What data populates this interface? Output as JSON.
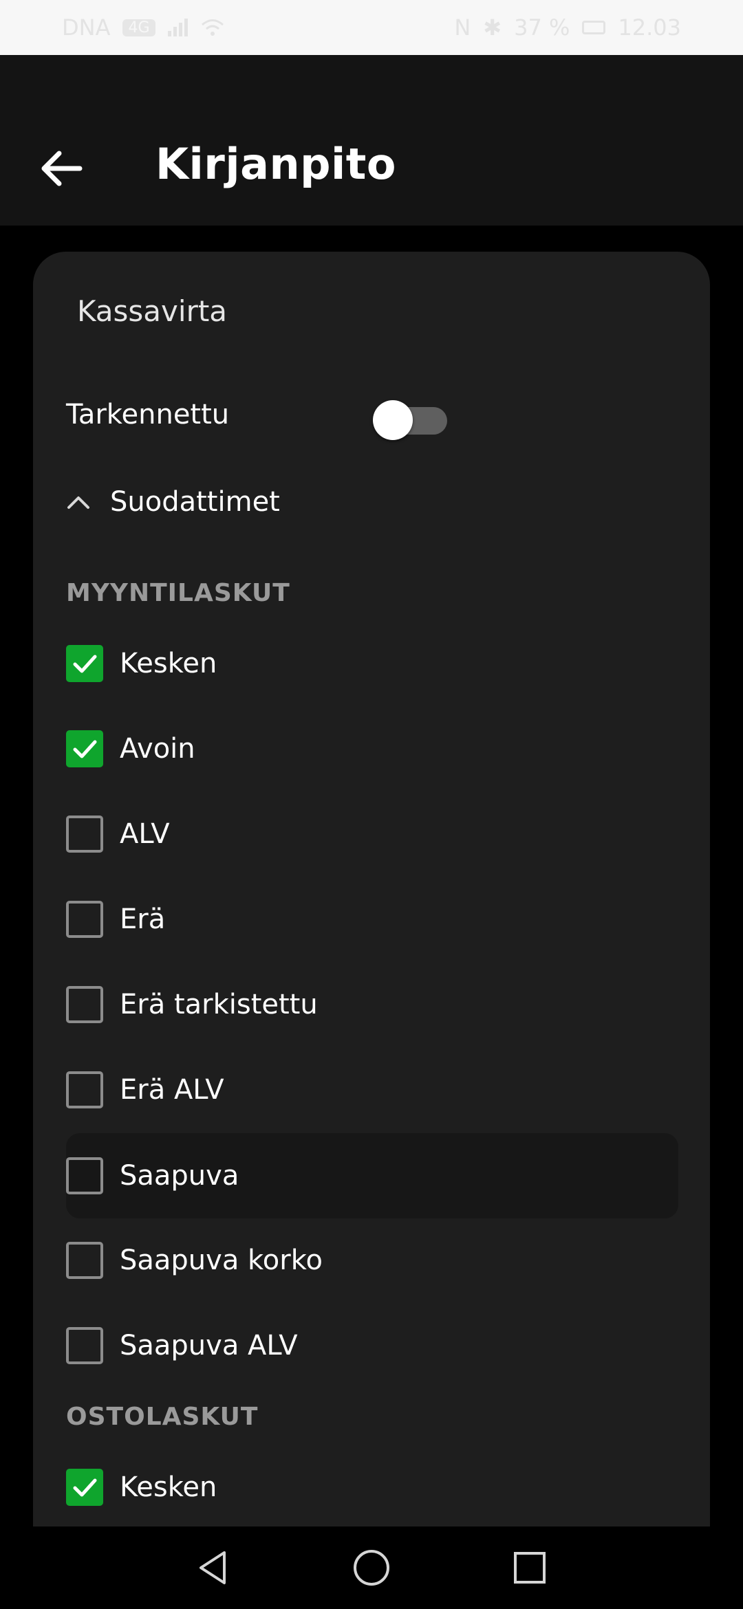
{
  "status_bar": {
    "carrier": "DNA",
    "network": "4G",
    "battery": "37 %",
    "time": "12.03"
  },
  "app_bar": {
    "title": "Kirjanpito"
  },
  "card": {
    "title": "Kassavirta",
    "advanced_label": "Tarkennettu",
    "advanced_enabled": false,
    "filters_label": "Suodattimet"
  },
  "sections": [
    {
      "header": "MYYNTILASKUT",
      "items": [
        {
          "label": "Kesken",
          "checked": true
        },
        {
          "label": "Avoin",
          "checked": true
        },
        {
          "label": "ALV",
          "checked": false
        },
        {
          "label": "Erä",
          "checked": false
        },
        {
          "label": "Erä tarkistettu",
          "checked": false
        },
        {
          "label": "Erä ALV",
          "checked": false
        },
        {
          "label": "Saapuva",
          "checked": false
        },
        {
          "label": "Saapuva korko",
          "checked": false
        },
        {
          "label": "Saapuva ALV",
          "checked": false
        }
      ]
    },
    {
      "header": "OSTOLASKUT",
      "items": [
        {
          "label": "Kesken",
          "checked": true
        }
      ]
    }
  ],
  "colors": {
    "checked": "#0fa52d",
    "card": "#1e1e1e",
    "app_bar": "#141414"
  }
}
